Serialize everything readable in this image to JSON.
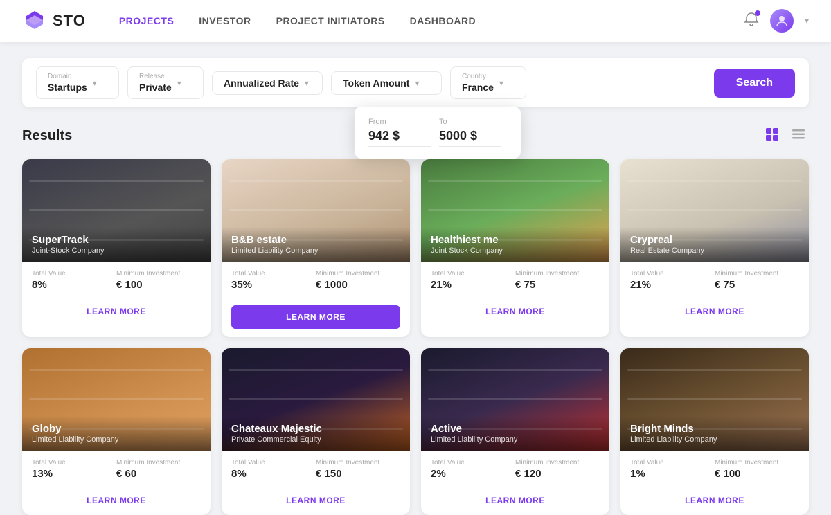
{
  "header": {
    "logo_text": "STO",
    "nav": [
      {
        "label": "PROJECTS",
        "active": true
      },
      {
        "label": "INVESTOR",
        "active": false
      },
      {
        "label": "PROJECT INITIATORS",
        "active": false
      },
      {
        "label": "DASHBOARD",
        "active": false
      }
    ]
  },
  "filters": {
    "domain_label": "Domain",
    "domain_value": "Startups",
    "release_label": "Release",
    "release_value": "Private",
    "annualized_label": "Annualized Rate",
    "token_label": "Token Amount",
    "country_label": "Country",
    "country_value": "France",
    "search_label": "Search",
    "token_from_label": "From",
    "token_from_value": "942 $",
    "token_to_label": "To",
    "token_to_value": "5000 $"
  },
  "results": {
    "title": "Results",
    "cards": [
      {
        "id": 1,
        "name": "SuperTrack",
        "company_type": "Joint-Stock Company",
        "total_value_label": "Total Value",
        "total_value": "8%",
        "min_investment_label": "Minimum Investment",
        "min_investment": "€ 100",
        "learn_more": "LEARN MORE",
        "img_class": "img-warehouse",
        "filled": false
      },
      {
        "id": 2,
        "name": "B&B estate",
        "company_type": "Limited Liability Company",
        "total_value_label": "Total Value",
        "total_value": "35%",
        "min_investment_label": "Minimum Investment",
        "min_investment": "€ 1000",
        "learn_more": "LEARN MORE",
        "img_class": "img-interior",
        "filled": true
      },
      {
        "id": 3,
        "name": "Healthiest me",
        "company_type": "Joint Stock Company",
        "total_value_label": "Total Value",
        "total_value": "21%",
        "min_investment_label": "Minimum Investment",
        "min_investment": "€ 75",
        "learn_more": "LEARN MORE",
        "img_class": "img-food",
        "filled": false
      },
      {
        "id": 4,
        "name": "Crypreal",
        "company_type": "Real Estate Company",
        "total_value_label": "Total Value",
        "total_value": "21%",
        "min_investment_label": "Minimum Investment",
        "min_investment": "€ 75",
        "learn_more": "LEARN MORE",
        "img_class": "img-house",
        "filled": false
      },
      {
        "id": 5,
        "name": "Globy",
        "company_type": "Limited Liability Company",
        "total_value_label": "Total Value",
        "total_value": "13%",
        "min_investment_label": "Minimum Investment",
        "min_investment": "€ 60",
        "learn_more": "LEARN MORE",
        "img_class": "img-boxes",
        "filled": false
      },
      {
        "id": 6,
        "name": "Chateaux Majestic",
        "company_type": "Private Commercial Equity",
        "total_value_label": "Total Value",
        "total_value": "8%",
        "min_investment_label": "Minimum Investment",
        "min_investment": "€ 150",
        "learn_more": "LEARN MORE",
        "img_class": "img-phone",
        "filled": false
      },
      {
        "id": 7,
        "name": "Active",
        "company_type": "Limited Liability Company",
        "total_value_label": "Total Value",
        "total_value": "2%",
        "min_investment_label": "Minimum Investment",
        "min_investment": "€ 120",
        "learn_more": "LEARN MORE",
        "img_class": "img-gym",
        "filled": false
      },
      {
        "id": 8,
        "name": "Bright Minds",
        "company_type": "Limited Liability Company",
        "total_value_label": "Total Value",
        "total_value": "1%",
        "min_investment_label": "Minimum Investment",
        "min_investment": "€ 100",
        "learn_more": "LEARN MORE",
        "img_class": "img-studio",
        "filled": false
      }
    ]
  }
}
